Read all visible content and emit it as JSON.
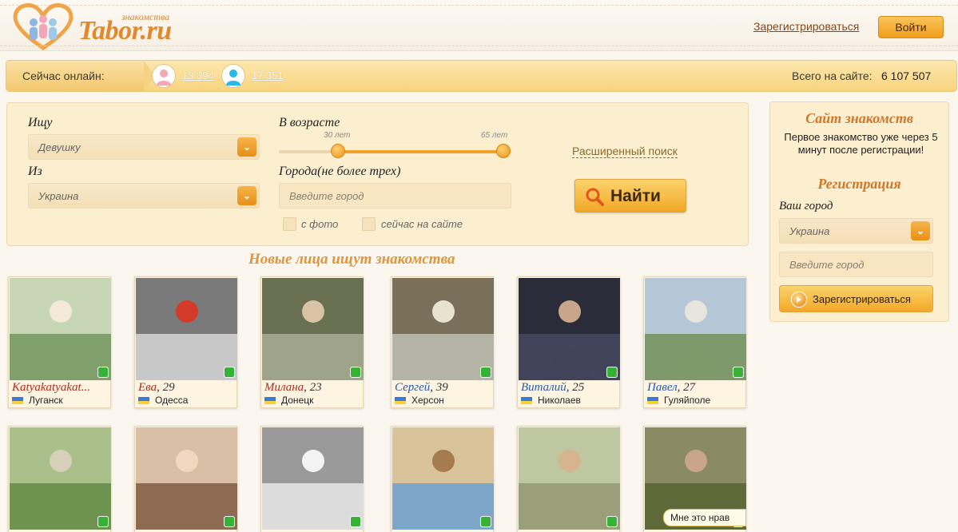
{
  "header": {
    "logo_small": "знакомства",
    "logo_text": "Tabor.ru",
    "register_link": "Зарегистрироваться",
    "login_button": "Войти"
  },
  "online_bar": {
    "label": "Сейчас онлайн:",
    "women_count": "13 394",
    "men_count": "17 351",
    "total_label": "Всего на сайте:",
    "total_value": "6 107 507"
  },
  "search": {
    "seek_label": "Ищу",
    "seek_value": "Девушку",
    "from_label": "Из",
    "from_value": "Украина",
    "age_label": "В возрасте",
    "age_min_label": "30 лет",
    "age_max_label": "65 лет",
    "age_min": 30,
    "age_max": 65,
    "age_scale_min": 18,
    "age_scale_max": 65,
    "cities_label": "Города(не более трех)",
    "city_placeholder": "Введите город",
    "with_photo_label": "с фото",
    "online_now_label": "сейчас на сайте",
    "advanced_link": "Расширенный поиск",
    "find_button": "Найти"
  },
  "new_faces": {
    "heading": "Новые лица ищут знакомства",
    "cards": [
      {
        "name": "Katyakatyakat...",
        "age": "",
        "city": "Луганск",
        "gender": "female",
        "status": "mobile"
      },
      {
        "name": "Ева",
        "age": ", 29",
        "city": "Одесса",
        "gender": "female",
        "status": "mobile"
      },
      {
        "name": "Милана",
        "age": ", 23",
        "city": "Донецк",
        "gender": "female",
        "status": "online"
      },
      {
        "name": "Сергей",
        "age": ", 39",
        "city": "Херсон",
        "gender": "male",
        "status": "mobile"
      },
      {
        "name": "Виталий",
        "age": ", 25",
        "city": "Николаев",
        "gender": "male",
        "status": "mobile"
      },
      {
        "name": "Павел",
        "age": ", 27",
        "city": "Гуляйполе",
        "gender": "male",
        "status": "mobile"
      },
      {
        "name": "",
        "age": "",
        "city": "",
        "gender": "female",
        "status": "mobile"
      },
      {
        "name": "",
        "age": "",
        "city": "",
        "gender": "female",
        "status": "mobile"
      },
      {
        "name": "",
        "age": "",
        "city": "",
        "gender": "female",
        "status": "mobile"
      },
      {
        "name": "",
        "age": "",
        "city": "",
        "gender": "male",
        "status": "online"
      },
      {
        "name": "",
        "age": "",
        "city": "",
        "gender": "male",
        "status": "mobile"
      },
      {
        "name": "",
        "age": "",
        "city": "",
        "gender": "male",
        "status": "mobile"
      }
    ],
    "tooltip_text": "Мне это нрав"
  },
  "sidebar": {
    "title": "Сайт знакомств",
    "text": "Первое знакомство уже через 5 минут после регистрации!",
    "reg_title": "Регистрация",
    "city_label": "Ваш город",
    "country_value": "Украина",
    "city_placeholder": "Введите город",
    "register_button": "Зарегистрироваться"
  },
  "colors": {
    "accent": "#f2a828",
    "brand": "#e2892b",
    "female_name": "#b52c1c",
    "male_name": "#2a5aa8",
    "online_green": "#36b234"
  }
}
